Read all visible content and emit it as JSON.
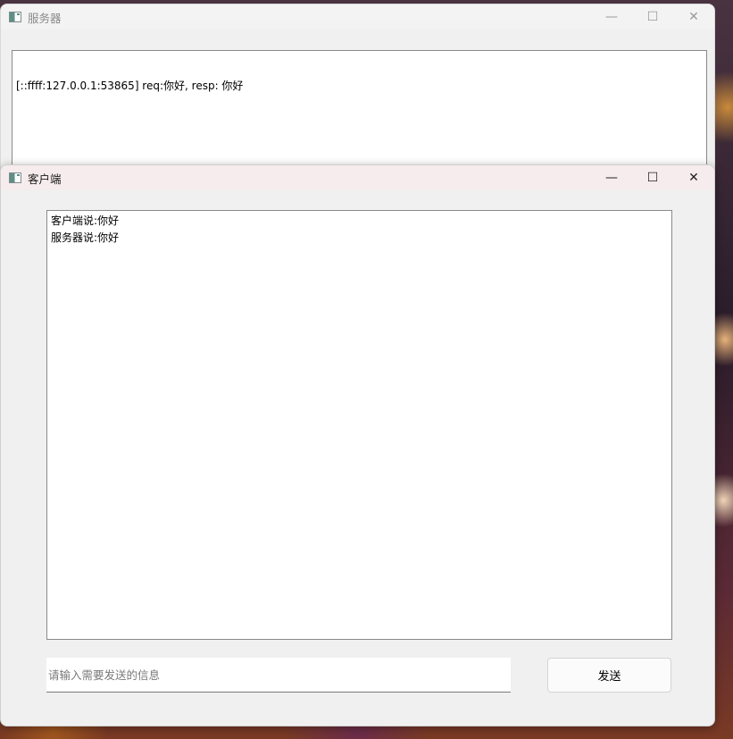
{
  "server_window": {
    "title": "服务器",
    "icon": "app-window-icon",
    "controls": {
      "minimize": "—",
      "maximize": "☐",
      "close": "✕"
    },
    "log_lines": [
      "[::ffff:127.0.0.1:53865] req:你好, resp: 你好"
    ]
  },
  "client_window": {
    "title": "客户端",
    "icon": "app-window-icon",
    "controls": {
      "minimize": "—",
      "maximize": "☐",
      "close": "✕"
    },
    "chat_lines": [
      "客户端说:你好",
      "服务器说:你好"
    ],
    "input": {
      "value": "",
      "placeholder": "请输入需要发送的信息"
    },
    "send_button_label": "发送"
  }
}
